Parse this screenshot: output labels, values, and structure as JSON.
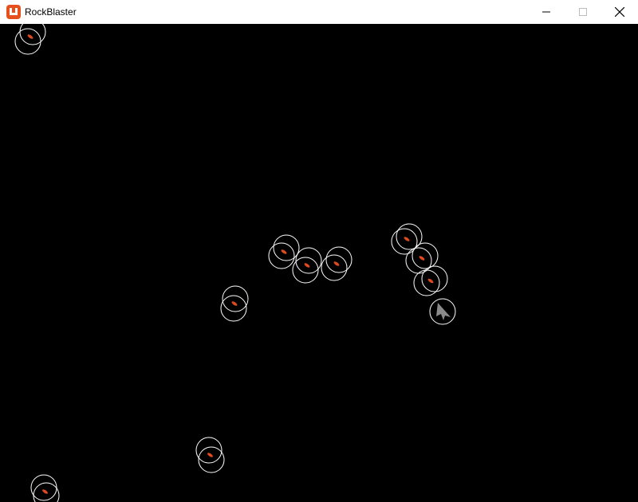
{
  "window": {
    "title": "RockBlaster",
    "icon": "monogame-logo-icon",
    "controls": [
      "minimize-icon",
      "maximize-icon",
      "close-icon"
    ]
  },
  "game": {
    "background": "#000000",
    "collision_circle_color": "#ffffff",
    "rock_color": "#e04a1f",
    "ship_color": "#8a8a8a"
  }
}
